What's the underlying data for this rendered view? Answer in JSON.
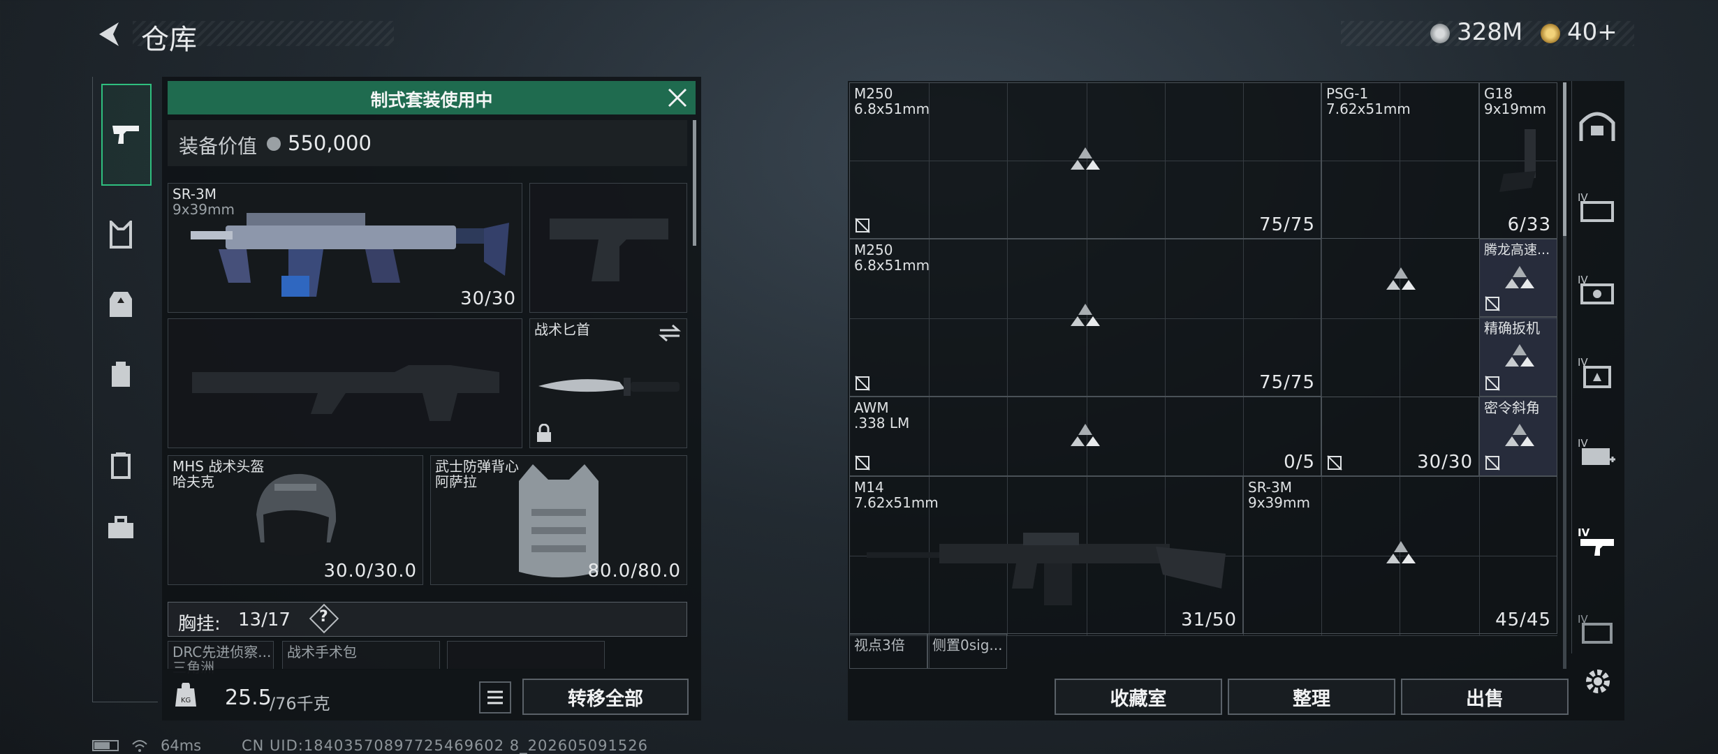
{
  "header": {
    "title": "仓库",
    "currency_silver": "328M",
    "currency_gold": "40+"
  },
  "loadout": {
    "banner": "制式套装使用中",
    "value_label": "装备价值",
    "value": "550,000",
    "primary": {
      "name": "SR-3M",
      "caliber": "9x39mm",
      "ammo": "30/30"
    },
    "knife": {
      "name": "战术匕首"
    },
    "helmet": {
      "name": "MHS 战术头盔",
      "map": "哈夫克",
      "durability": "30.0/30.0"
    },
    "armor": {
      "name": "武士防弹背心",
      "map": "阿萨拉",
      "durability": "80.0/80.0"
    },
    "rig_label": "胸挂:",
    "rig_count": "13/17",
    "rig_help": "?",
    "rig_items": [
      {
        "name": "DRC先进侦察...",
        "sub": "三角洲"
      },
      {
        "name": "战术手术包",
        "sub": ""
      }
    ],
    "weight_current": "25.5",
    "weight_max": "/76千克",
    "transfer_all": "转移全部"
  },
  "stash": {
    "items": [
      {
        "name": "M250",
        "caliber": "6.8x51mm",
        "count": "75/75"
      },
      {
        "name": "PSG-1",
        "caliber": "7.62x51mm",
        "count": ""
      },
      {
        "name": "G18",
        "caliber": "9x19mm",
        "count": "6/33"
      },
      {
        "name": "M250",
        "caliber": "6.8x51mm",
        "count": "75/75"
      },
      {
        "name": "腾龙高速...",
        "caliber": "",
        "count": ""
      },
      {
        "name": "精确扳机",
        "caliber": "",
        "count": ""
      },
      {
        "name": "AWM",
        "caliber": ".338 LM",
        "count": "0/5"
      },
      {
        "name": "",
        "caliber": "",
        "count": "30/30"
      },
      {
        "name": "密令斜角",
        "caliber": "",
        "count": ""
      },
      {
        "name": "M14",
        "caliber": "7.62x51mm",
        "count": "31/50"
      },
      {
        "name": "SR-3M",
        "caliber": "9x39mm",
        "count": "45/45"
      },
      {
        "name": "视点3倍",
        "caliber": "",
        "count": ""
      },
      {
        "name": "侧置0sig...",
        "caliber": "",
        "count": ""
      }
    ],
    "btn_collection": "收藏室",
    "btn_sort": "整理",
    "btn_sell": "出售"
  },
  "status": {
    "ping": "64ms",
    "uid": "CN UID:18403570897725469602 8_202605091526"
  },
  "colors": {
    "banner_green": "#1f6b4f",
    "accent_green": "#2fbf7f",
    "mod_slot_purple": "#3a3f5a"
  }
}
